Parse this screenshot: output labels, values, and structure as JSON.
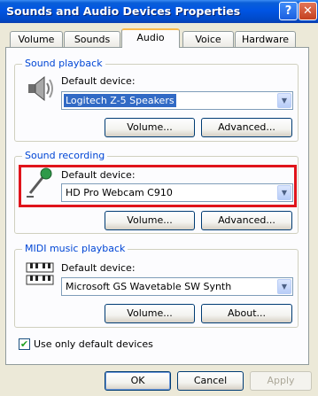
{
  "window": {
    "title": "Sounds and Audio Devices Properties",
    "help_label": "?",
    "close_label": "✕"
  },
  "tabs": [
    "Volume",
    "Sounds",
    "Audio",
    "Voice",
    "Hardware"
  ],
  "active_tab": "Audio",
  "sound_playback": {
    "group_label": "Sound playback",
    "default_device_label": "Default device:",
    "device": "Logitech Z-5 Speakers",
    "volume_button": "Volume...",
    "advanced_button": "Advanced...",
    "icon": "speaker-icon"
  },
  "sound_recording": {
    "group_label": "Sound recording",
    "default_device_label": "Default device:",
    "device": "HD Pro Webcam C910",
    "volume_button": "Volume...",
    "advanced_button": "Advanced...",
    "icon": "microphone-icon",
    "highlight_color": "#e0141b"
  },
  "midi_playback": {
    "group_label": "MIDI music playback",
    "default_device_label": "Default device:",
    "device": "Microsoft GS Wavetable SW Synth",
    "volume_button": "Volume...",
    "about_button": "About...",
    "icon": "midi-keyboard-icon"
  },
  "use_only_default": {
    "label": "Use only default devices",
    "checked": true
  },
  "footer": {
    "ok": "OK",
    "cancel": "Cancel",
    "apply": "Apply"
  },
  "colors": {
    "titlebar": "#0054e3",
    "dialog_bg": "#ece9d8",
    "group_label": "#0046d5",
    "tab_accent": "#f9b94b"
  }
}
